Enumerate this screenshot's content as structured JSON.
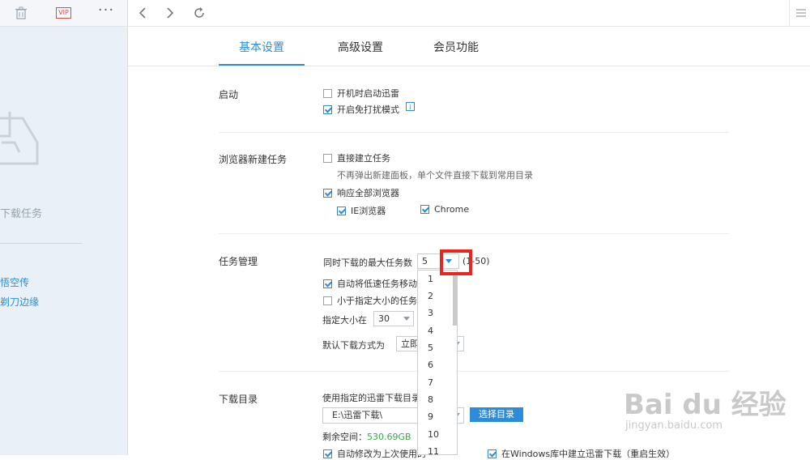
{
  "sidebar": {
    "vip_label": "VIP",
    "empty_label": "下载任务",
    "links": [
      "悟空传",
      "剃刀边缘"
    ]
  },
  "tabs": [
    "基本设置",
    "高级设置",
    "会员功能"
  ],
  "startup": {
    "title": "启动",
    "options": [
      {
        "label": "开机时启动迅雷",
        "checked": false
      },
      {
        "label": "开启免打扰模式",
        "checked": true
      }
    ],
    "info_icon": "i"
  },
  "browser": {
    "title": "浏览器新建任务",
    "direct_label": "直接建立任务",
    "direct_hint": "不再弹出新建面板，单个文件直接下载到常用目录",
    "respond_label": "响应全部浏览器",
    "ie_label": "IE浏览器",
    "chrome_label": "Chrome"
  },
  "task_mgmt": {
    "title": "任务管理",
    "max_label": "同时下载的最大任务数",
    "max_value": "5",
    "range_text": "(1-50)",
    "auto_move_label": "自动将低速任务移动至",
    "small_label": "小于指定大小的任务不",
    "size_label": "指定大小在",
    "size_value": "30",
    "default_mode_label": "默认下载方式为",
    "default_mode_value": "立即"
  },
  "dropdown_items": [
    "1",
    "2",
    "3",
    "4",
    "5",
    "6",
    "7",
    "8",
    "9",
    "10",
    "11"
  ],
  "download_dir": {
    "title": "下载目录",
    "use_label": "使用指定的迅雷下载目录",
    "path": "E:\\迅雷下载\\",
    "choose_button": "选择目录",
    "free_label": "剩余空间：",
    "free_value": "530.69GB",
    "auto_label": "自动修改为上次使用的",
    "win_label": "在Windows库中建立迅雷下载（重启生效）"
  },
  "watermark": {
    "main": "Bai du 经验",
    "sub": "jingyan.baidu.com"
  }
}
